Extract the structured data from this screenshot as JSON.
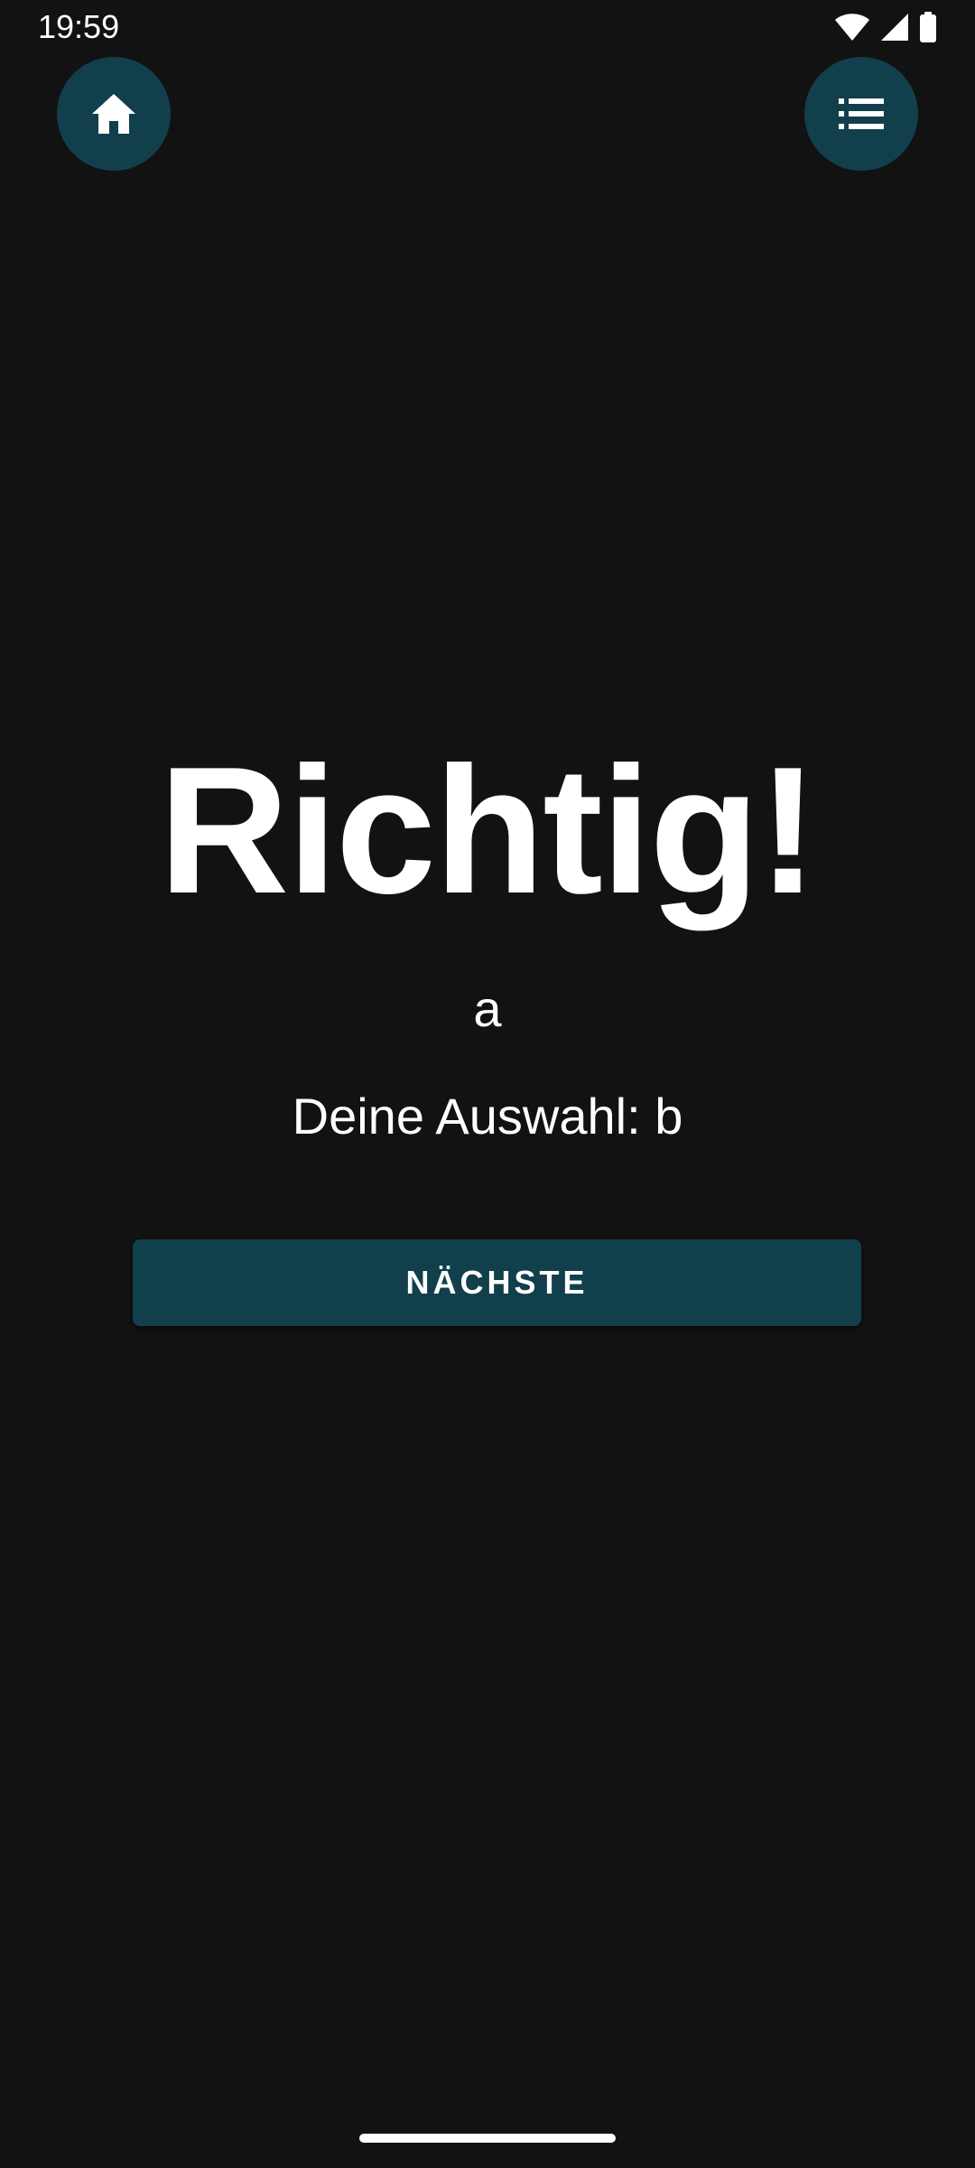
{
  "status_bar": {
    "time": "19:59",
    "icons": [
      "wifi-icon",
      "cellular-signal-icon",
      "battery-icon"
    ]
  },
  "toolbar": {
    "home_icon": "home-icon",
    "list_icon": "list-icon"
  },
  "result": {
    "title": "Richtig!",
    "answer": "a",
    "choice": "Deine Auswahl: b"
  },
  "actions": {
    "next_label": "NÄCHSTE"
  },
  "colors": {
    "background": "#121212",
    "accent": "#123f4c",
    "text": "#ffffff"
  }
}
